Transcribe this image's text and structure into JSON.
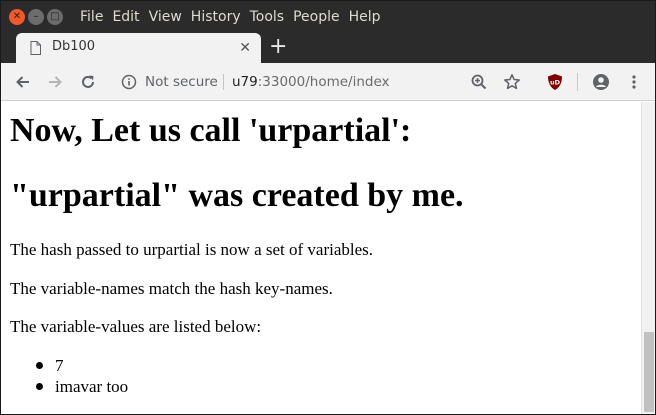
{
  "menu": [
    "File",
    "Edit",
    "View",
    "History",
    "Tools",
    "People",
    "Help"
  ],
  "tab": {
    "title": "Db100",
    "close": "✕"
  },
  "new_tab": "+",
  "omnibox": {
    "security": "Not secure",
    "url_host": "u79",
    "url_rest": ":33000/home/index"
  },
  "icons": {
    "back": "arrow-left-icon",
    "forward": "arrow-right-icon",
    "reload": "reload-icon",
    "info": "info-icon",
    "zoom": "zoom-icon",
    "bookmark": "star-icon",
    "extension": "ublock-icon",
    "profile": "account-icon",
    "menu": "more-vertical-icon"
  },
  "page": {
    "heading1": "Now, Let us call 'urpartial':",
    "heading2": "\"urpartial\" was created by me.",
    "paragraphs": [
      "The hash passed to urpartial is now a set of variables.",
      "The variable-names match the hash key-names.",
      "The variable-values are listed below:"
    ],
    "list": [
      "7",
      "imavar too"
    ]
  },
  "colors": {
    "chrome_dark": "#2b2b2b",
    "toolbar": "#f2f2f2",
    "close_button": "#f05a2a",
    "ublock": "#800000"
  }
}
